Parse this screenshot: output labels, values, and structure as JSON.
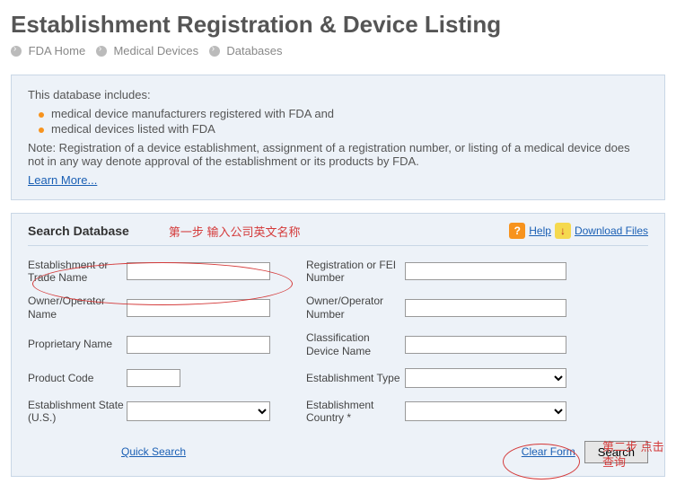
{
  "page_title": "Establishment Registration & Device Listing",
  "breadcrumb": [
    "FDA Home",
    "Medical Devices",
    "Databases"
  ],
  "info_panel": {
    "intro": "This database includes:",
    "bullets": [
      "medical device manufacturers registered with FDA and",
      "medical devices listed with FDA"
    ],
    "note": "Note: Registration of a device establishment, assignment of a registration number, or listing of a medical device does not in any way denote approval of the establishment or its products by FDA.",
    "learn_more": "Learn More..."
  },
  "search": {
    "title": "Search Database",
    "annotation_step1": "第一步 输入公司英文名称",
    "help_label": "Help",
    "download_label": "Download Files",
    "fields": {
      "est_trade_name": "Establishment or Trade Name",
      "reg_fei": "Registration or FEI Number",
      "owner_name": "Owner/Operator Name",
      "owner_number": "Owner/Operator Number",
      "proprietary": "Proprietary Name",
      "class_device": "Classification Device Name",
      "product_code": "Product Code",
      "est_type": "Establishment Type",
      "est_state": "Establishment State (U.S.)",
      "est_country": "Establishment Country *"
    },
    "values": {
      "est_trade_name": "",
      "reg_fei": "",
      "owner_name": "",
      "owner_number": "",
      "proprietary": "",
      "class_device": "",
      "product_code": "",
      "est_type": "",
      "est_state": "",
      "est_country": ""
    },
    "quick_search": "Quick Search",
    "clear_form": "Clear Form",
    "search_button": "Search",
    "annotation_step2": "第二步 点击查询"
  }
}
